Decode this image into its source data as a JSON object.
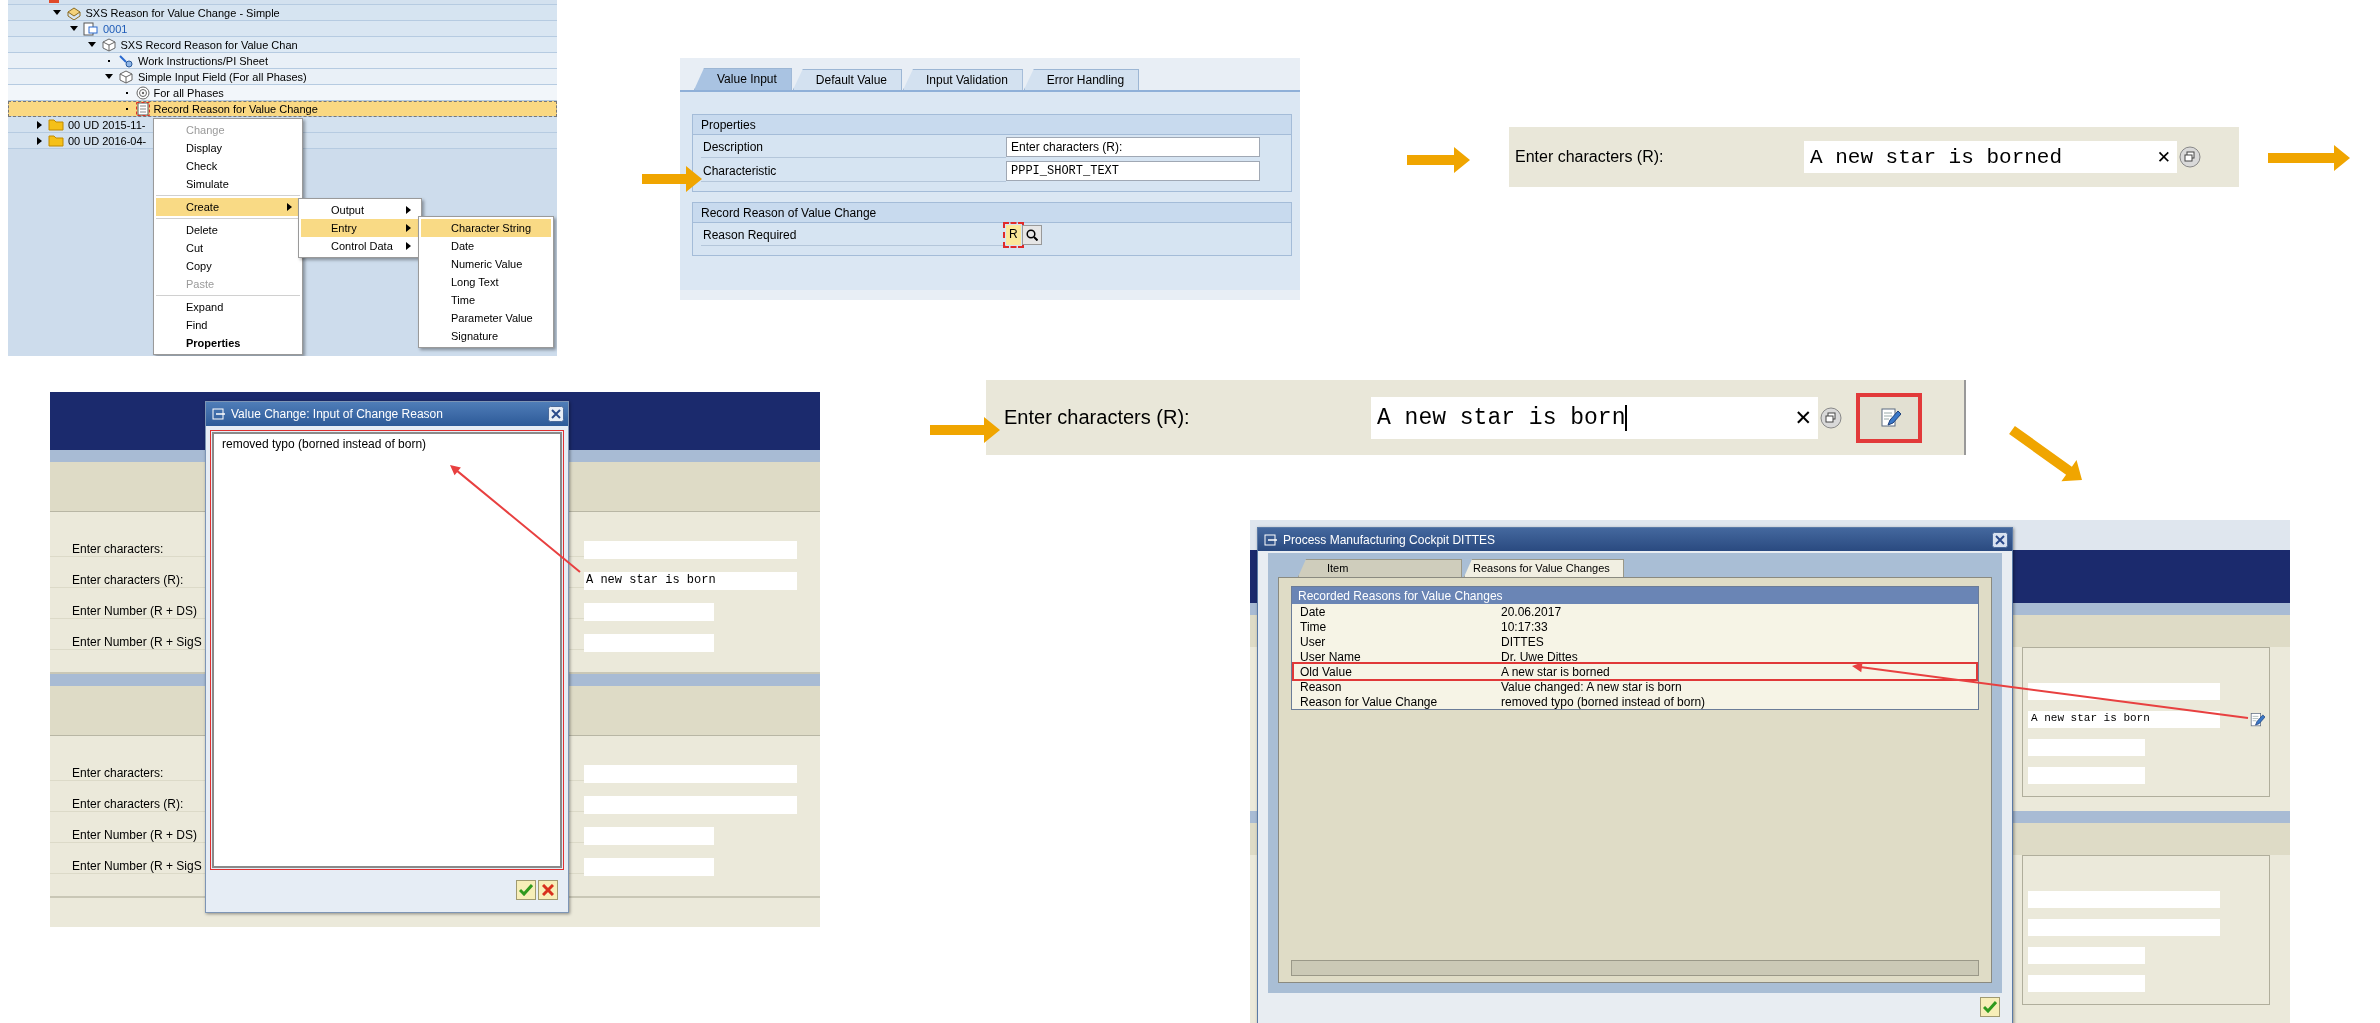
{
  "tree_panel": {
    "tree": [
      {
        "kind": "recipe-group",
        "expanded": true,
        "selected": false,
        "children": [
          {
            "label": "SXS Reason for Value Change - Simple",
            "kind": "recipe",
            "expanded": true,
            "selected": false,
            "children": [
              {
                "label": "0001",
                "kind": "operation",
                "expanded": true,
                "selected": false,
                "children": [
                  {
                    "label": "SXS Record Reason for Value Chan",
                    "kind": "phase",
                    "expanded": true,
                    "selected": false,
                    "children": [
                      {
                        "label": "Work Instructions/PI Sheet",
                        "kind": "instruction",
                        "selected": false
                      },
                      {
                        "label": "Simple Input Field (For all Phases)",
                        "kind": "phase",
                        "expanded": true,
                        "selected": false,
                        "children": [
                          {
                            "label": "For all Phases",
                            "kind": "target",
                            "selected": false
                          },
                          {
                            "label": "Record Reason for Value Change",
                            "kind": "document",
                            "selected": true
                          }
                        ]
                      }
                    ]
                  }
                ]
              }
            ]
          }
        ]
      },
      {
        "label": "00 UD 2015-11-",
        "kind": "folder",
        "expanded": false,
        "selected": false
      },
      {
        "label": "00 UD 2016-04-",
        "kind": "folder",
        "expanded": false,
        "selected": false
      }
    ],
    "context_menu": [
      {
        "kind": "item",
        "label": "Change",
        "disabled": true,
        "selected": false,
        "submenu": false,
        "default": false
      },
      {
        "kind": "item",
        "label": "Display",
        "disabled": false,
        "selected": false,
        "submenu": false,
        "default": false
      },
      {
        "kind": "item",
        "label": "Check",
        "disabled": false,
        "selected": false,
        "submenu": false,
        "default": false
      },
      {
        "kind": "item",
        "label": "Simulate",
        "disabled": false,
        "selected": false,
        "submenu": false,
        "default": false
      },
      {
        "kind": "separator"
      },
      {
        "kind": "item",
        "label": "Create",
        "disabled": false,
        "selected": true,
        "submenu": true,
        "default": false
      },
      {
        "kind": "separator"
      },
      {
        "kind": "item",
        "label": "Delete",
        "disabled": false,
        "selected": false,
        "submenu": false,
        "default": false
      },
      {
        "kind": "item",
        "label": "Cut",
        "disabled": false,
        "selected": false,
        "submenu": false,
        "default": false
      },
      {
        "kind": "item",
        "label": "Copy",
        "disabled": false,
        "selected": false,
        "submenu": false,
        "default": false
      },
      {
        "kind": "item",
        "label": "Paste",
        "disabled": true,
        "selected": false,
        "submenu": false,
        "default": false
      },
      {
        "kind": "separator"
      },
      {
        "kind": "item",
        "label": "Expand",
        "disabled": false,
        "selected": false,
        "submenu": false,
        "default": false
      },
      {
        "kind": "item",
        "label": "Find",
        "disabled": false,
        "selected": false,
        "submenu": false,
        "default": false
      },
      {
        "kind": "item",
        "label": "Properties",
        "disabled": false,
        "selected": false,
        "submenu": false,
        "default": true
      }
    ],
    "create_submenu": [
      {
        "kind": "item",
        "label": "Output",
        "disabled": false,
        "selected": false,
        "submenu": true,
        "default": false
      },
      {
        "kind": "item",
        "label": "Entry",
        "disabled": false,
        "selected": true,
        "submenu": true,
        "default": false
      },
      {
        "kind": "item",
        "label": "Control Data",
        "disabled": false,
        "selected": false,
        "submenu": true,
        "default": false
      }
    ],
    "entry_submenu": [
      {
        "kind": "item",
        "label": "Character String",
        "disabled": false,
        "selected": true,
        "submenu": false,
        "default": false
      },
      {
        "kind": "item",
        "label": "Date",
        "disabled": false,
        "selected": false,
        "submenu": false,
        "default": false
      },
      {
        "kind": "item",
        "label": "Numeric Value",
        "disabled": false,
        "selected": false,
        "submenu": false,
        "default": false
      },
      {
        "kind": "item",
        "label": "Long Text",
        "disabled": false,
        "selected": false,
        "submenu": false,
        "default": false
      },
      {
        "kind": "item",
        "label": "Time",
        "disabled": false,
        "selected": false,
        "submenu": false,
        "default": false
      },
      {
        "kind": "item",
        "label": "Parameter Value",
        "disabled": false,
        "selected": false,
        "submenu": false,
        "default": false
      },
      {
        "kind": "item",
        "label": "Signature",
        "disabled": false,
        "selected": false,
        "submenu": false,
        "default": false
      }
    ]
  },
  "properties_panel": {
    "tabs": [
      {
        "label": "Value Input",
        "selected": true
      },
      {
        "label": "Default Value",
        "selected": false
      },
      {
        "label": "Input Validation",
        "selected": false
      },
      {
        "label": "Error Handling",
        "selected": false
      }
    ],
    "groups": [
      {
        "title": "Properties",
        "rows": [
          {
            "label": "Description",
            "kind": "text",
            "value": "Enter characters (R):"
          },
          {
            "label": "Characteristic",
            "kind": "mono",
            "value": "PPPI_SHORT_TEXT"
          }
        ]
      },
      {
        "title": "Record Reason of Value Change",
        "rows": [
          {
            "label": "Reason Required",
            "kind": "lookup",
            "value": "R"
          }
        ]
      }
    ]
  },
  "entry_before": {
    "label": "Enter characters (R):",
    "value": "A new star is borned",
    "clear": "✕"
  },
  "entry_after": {
    "label": "Enter characters (R):",
    "value": "A new star is born",
    "clear": "✕",
    "edit_button": true,
    "highlighted": true
  },
  "reason_screen": {
    "sections": [
      {
        "rows": [
          {
            "label": "Enter characters:",
            "kind": "text"
          },
          {
            "label": "Enter characters (R):",
            "kind": "text",
            "value": "A new star is born"
          },
          {
            "label": "Enter Number (R + DS)",
            "kind": "number"
          },
          {
            "label": "Enter Number (R + SigS",
            "kind": "number"
          }
        ]
      },
      {
        "rows": [
          {
            "label": "Enter characters:",
            "kind": "text"
          },
          {
            "label": "Enter characters (R):",
            "kind": "text"
          },
          {
            "label": "Enter Number (R + DS)",
            "kind": "number"
          },
          {
            "label": "Enter Number (R + SigS",
            "kind": "number"
          }
        ]
      }
    ],
    "dialog": {
      "title": "Value Change: Input of Change Reason",
      "text": "removed typo (borned instead of born)"
    }
  },
  "cockpit_screen": {
    "sections": [
      {
        "fields": [
          {
            "kind": "text",
            "changed": false
          },
          {
            "kind": "text",
            "value": "A new star is born",
            "changed": true
          },
          {
            "kind": "number",
            "changed": false
          },
          {
            "kind": "number",
            "changed": false
          }
        ]
      },
      {
        "fields": [
          {
            "kind": "text",
            "changed": false
          },
          {
            "kind": "text",
            "changed": false
          },
          {
            "kind": "number",
            "changed": false
          },
          {
            "kind": "number",
            "changed": false
          }
        ]
      }
    ],
    "dialog": {
      "title": "Process Manufacturing Cockpit DITTES",
      "tabs": [
        {
          "label": "Item",
          "selected": false
        },
        {
          "label": "Reasons for Value Changes",
          "selected": true
        }
      ],
      "group_title": "Recorded Reasons for Value Changes",
      "rows": [
        {
          "label": "Date",
          "value": "20.06.2017",
          "highlighted": false
        },
        {
          "label": "Time",
          "value": "10:17:33",
          "highlighted": false
        },
        {
          "label": "User",
          "value": "DITTES",
          "highlighted": false
        },
        {
          "label": "User Name",
          "value": "Dr. Uwe Dittes",
          "highlighted": false
        },
        {
          "label": "Old Value",
          "value": "A new star is borned",
          "highlighted": true
        },
        {
          "label": "Reason",
          "value": "Value changed: A new star is born",
          "highlighted": false
        },
        {
          "label": "Reason for Value Change",
          "value": "removed typo (borned instead of born)",
          "highlighted": false
        }
      ]
    }
  }
}
